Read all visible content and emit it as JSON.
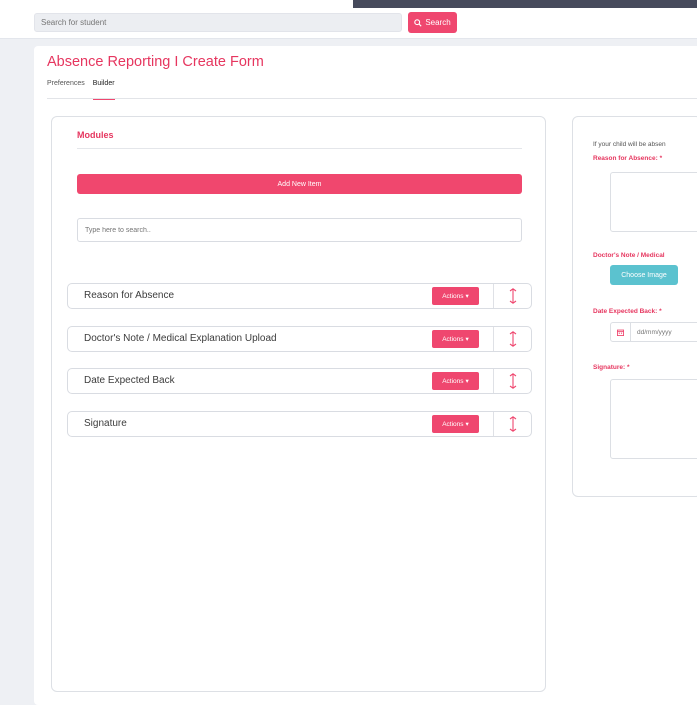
{
  "topbar": {
    "search_placeholder": "Search for student",
    "search_button": "Search"
  },
  "page": {
    "title": "Absence Reporting I Create Form",
    "tabs": [
      {
        "label": "Preferences",
        "active": false
      },
      {
        "label": "Builder",
        "active": true
      }
    ]
  },
  "modules": {
    "title": "Modules",
    "add_button": "Add New Item",
    "search_placeholder": "Type here to search..",
    "items": [
      {
        "label": "Reason for Absence",
        "actions_label": "Actions"
      },
      {
        "label": "Doctor's Note / Medical Explanation Upload",
        "actions_label": "Actions"
      },
      {
        "label": "Date Expected Back",
        "actions_label": "Actions"
      },
      {
        "label": "Signature",
        "actions_label": "Actions"
      }
    ]
  },
  "preview": {
    "intro": "If your child will be absen",
    "reason_label": "Reason for Absence: *",
    "doctor_label": "Doctor's Note / Medical",
    "choose_button": "Choose Image",
    "date_label": "Date Expected Back: *",
    "date_placeholder": "dd/mm/yyyy",
    "signature_label": "Signature: *"
  },
  "colors": {
    "accent": "#ef476f",
    "teal": "#5bc2cf",
    "background": "#464a5c"
  }
}
